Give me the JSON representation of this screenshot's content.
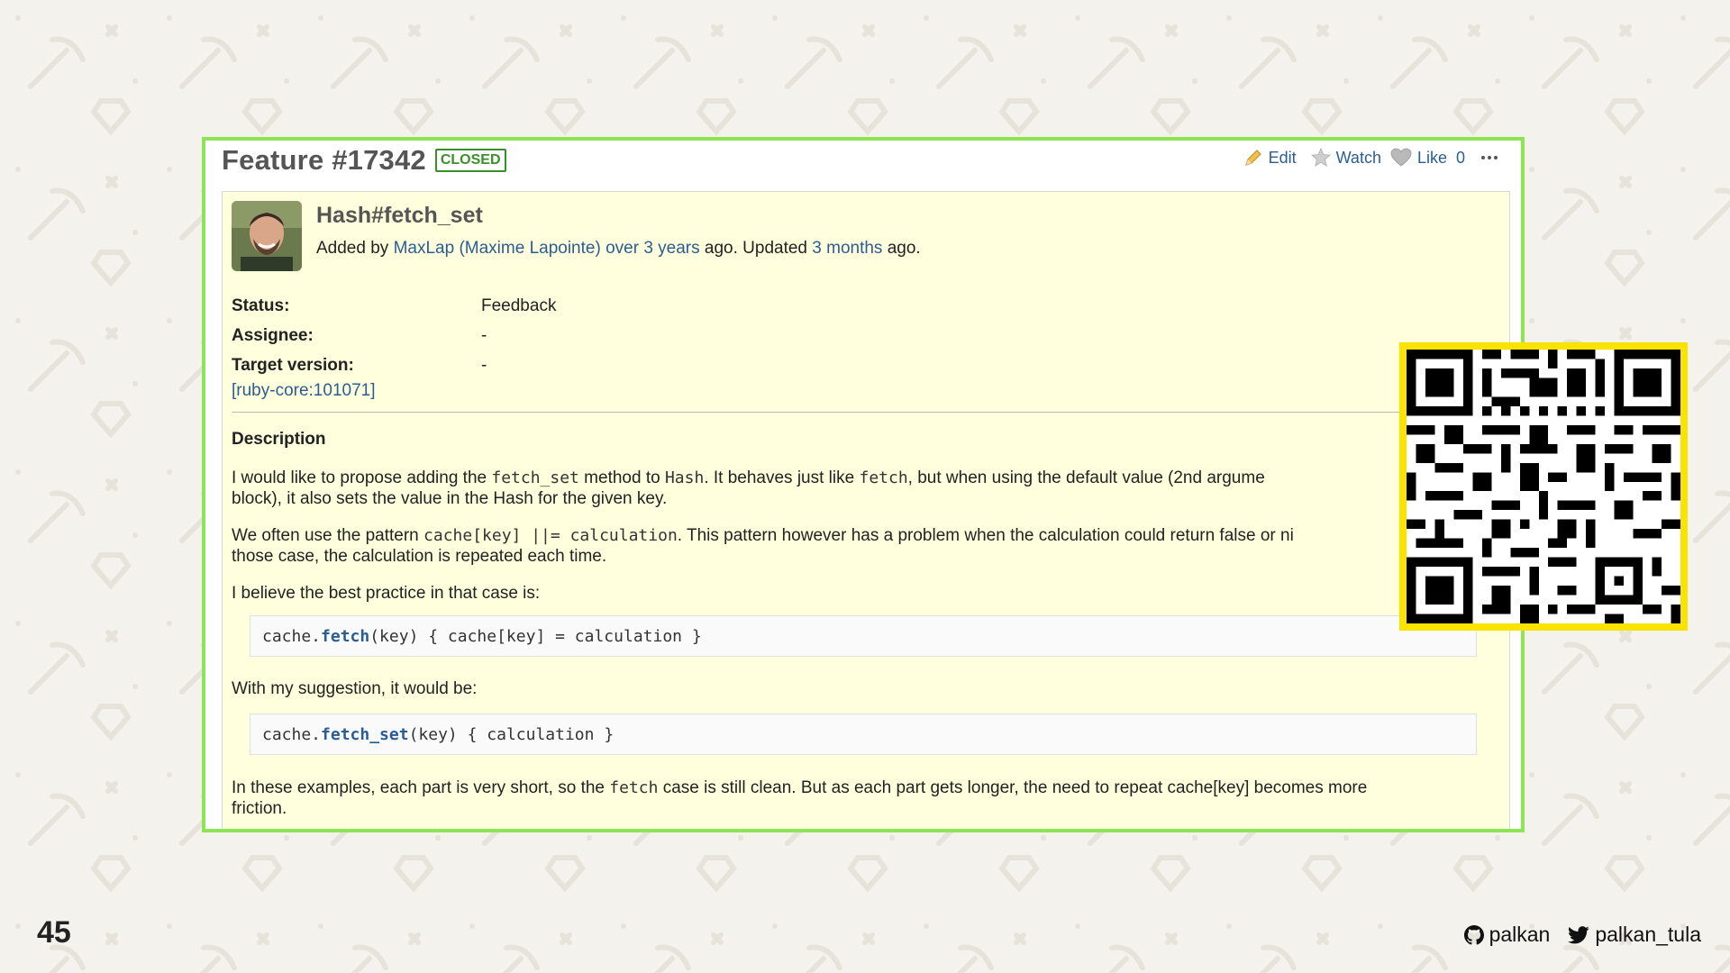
{
  "slide": {
    "page_number": "45"
  },
  "issue": {
    "title": "Feature #17342",
    "status_badge": "CLOSED",
    "actions": {
      "edit": "Edit",
      "watch": "Watch",
      "like": "Like",
      "like_count": "0"
    },
    "subject": "Hash#fetch_set",
    "byline": {
      "prefix": "Added by ",
      "author": "MaxLap (Maxime Lapointe)",
      "created": "over 3 years",
      "mid": " ago. Updated ",
      "updated": "3 months",
      "suffix": " ago."
    },
    "attributes": [
      {
        "label": "Status:",
        "value": "Feedback"
      },
      {
        "label": "Assignee:",
        "value": "-"
      },
      {
        "label": "Target version:",
        "value": "-"
      }
    ],
    "reference": "[ruby-core:101071]",
    "description_heading": "Description",
    "description": {
      "p1_a": "I would like to propose adding the ",
      "p1_code1": "fetch_set",
      "p1_b": " method to ",
      "p1_code2": "Hash",
      "p1_c": ". It behaves just like ",
      "p1_code3": "fetch",
      "p1_d": ", but when using the default value (2nd argume",
      "p1_e": "block), it also sets the value in the Hash for the given key.",
      "p2_a": "We often use the pattern ",
      "p2_code": "cache[key] ||= calculation",
      "p2_b": ". This pattern however has a problem when the calculation could return false or ni",
      "p2_c": "those case, the calculation is repeated each time.",
      "p3": "I believe the best practice in that case is:",
      "code1": {
        "pre": "cache.",
        "kw": "fetch",
        "post": "(key) { cache[key] = calculation }"
      },
      "p4": "With my suggestion, it would be:",
      "code2": {
        "pre": "cache.",
        "kw": "fetch_set",
        "post": "(key) { calculation }"
      },
      "p5_a": "In these examples, each part is very short, so the ",
      "p5_code": "fetch",
      "p5_b": " case is still clean. But as each part gets longer, the need to repeat cache[key] becomes more",
      "p5_c": "friction."
    }
  },
  "footer": {
    "github": "palkan",
    "twitter": "palkan_tula"
  },
  "colors": {
    "card_border": "#8ee553",
    "panel_bg": "#ffffdd",
    "link": "#2a5e93",
    "badge": "#3a8f29",
    "qr_frame": "#fbe300"
  },
  "icons": [
    "pencil-icon",
    "star-icon",
    "heart-icon",
    "more-icon",
    "github-icon",
    "twitter-icon",
    "qr-code"
  ]
}
